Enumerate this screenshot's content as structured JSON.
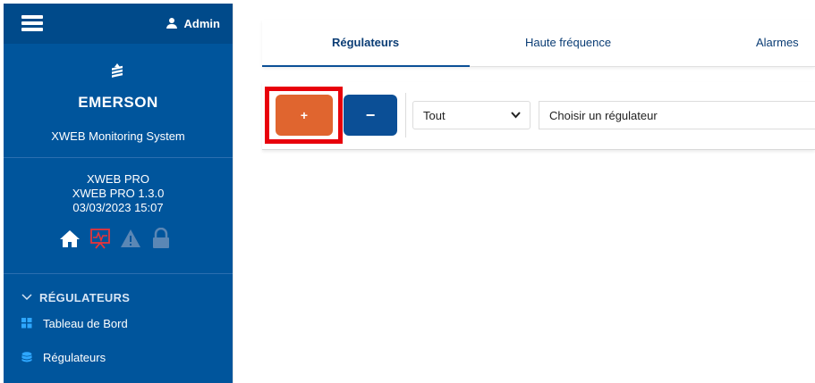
{
  "header": {
    "user_label": "Admin"
  },
  "brand": {
    "name": "EMERSON",
    "system_name": "XWEB Monitoring System"
  },
  "device": {
    "model": "XWEB PRO",
    "version": "XWEB PRO 1.3.0",
    "datetime": "03/03/2023 15:07"
  },
  "status_icons": [
    "home-icon",
    "monitor-chart-icon",
    "warning-icon",
    "lock-icon"
  ],
  "nav": {
    "section_title": "RÉGULATEURS",
    "items": [
      {
        "label": "Tableau de Bord",
        "icon": "dashboard-grid-icon"
      },
      {
        "label": "Régulateurs",
        "icon": "database-icon"
      }
    ]
  },
  "tabs": [
    {
      "label": "Régulateurs",
      "active": true
    },
    {
      "label": "Haute fréquence",
      "active": false
    },
    {
      "label": "Alarmes",
      "active": false
    }
  ],
  "toolbar": {
    "add_label": "+",
    "remove_label": "−",
    "filter_value": "Tout",
    "controller_placeholder": "Choisir un régulateur"
  },
  "colors": {
    "sidebar": "#00559c",
    "add_button": "#e0652f",
    "remove_button": "#0b4f96",
    "highlight": "#e8000b",
    "tab_text": "#0b3d75"
  }
}
